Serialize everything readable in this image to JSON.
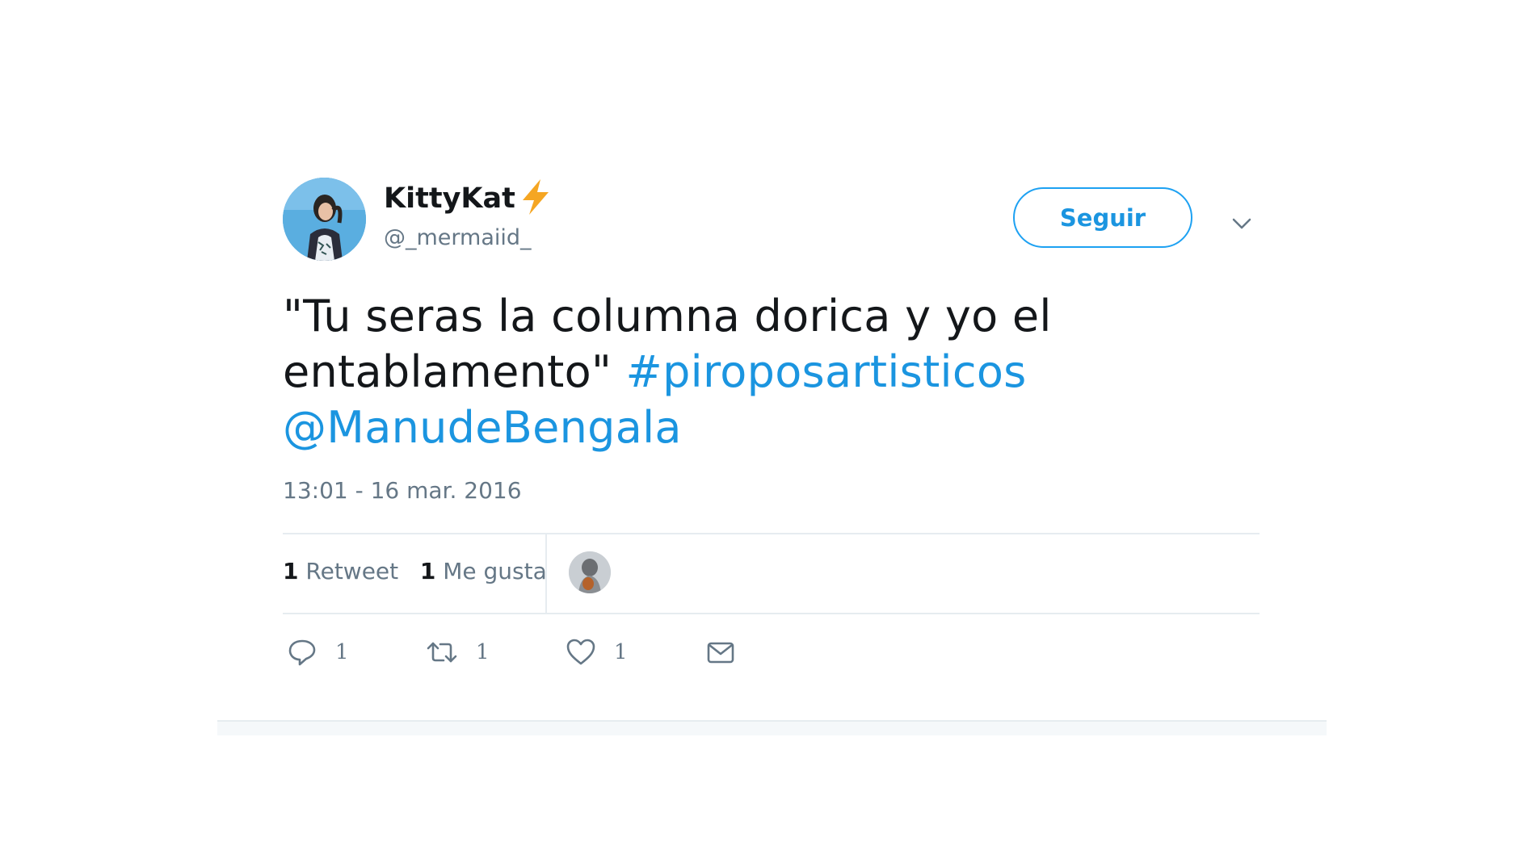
{
  "tweet": {
    "display_name": "KittyKat",
    "handle": "@_mermaiid_",
    "follow_label": "Seguir",
    "text_plain": "\"Tu seras la columna dorica y yo el entablamento\" ",
    "hashtag": "#piroposartisticos",
    "mention": "@ManudeBengala",
    "timestamp": "13:01 - 16 mar. 2016",
    "retweets_count": "1",
    "retweets_label": "Retweet",
    "likes_count": "1",
    "likes_label": "Me gusta",
    "actions": {
      "reply_count": "1",
      "retweet_count": "1",
      "like_count": "1"
    }
  },
  "colors": {
    "link": "#1b95e0",
    "text": "#14171a",
    "muted": "#657786",
    "divider": "#e6ecf0",
    "bolt": "#f5a623"
  },
  "icons": {
    "name_badge": "lightning-bolt-icon",
    "menu": "chevron-down-icon",
    "reply": "speech-bubble-icon",
    "retweet": "retweet-arrows-icon",
    "like": "heart-icon",
    "dm": "envelope-icon"
  }
}
